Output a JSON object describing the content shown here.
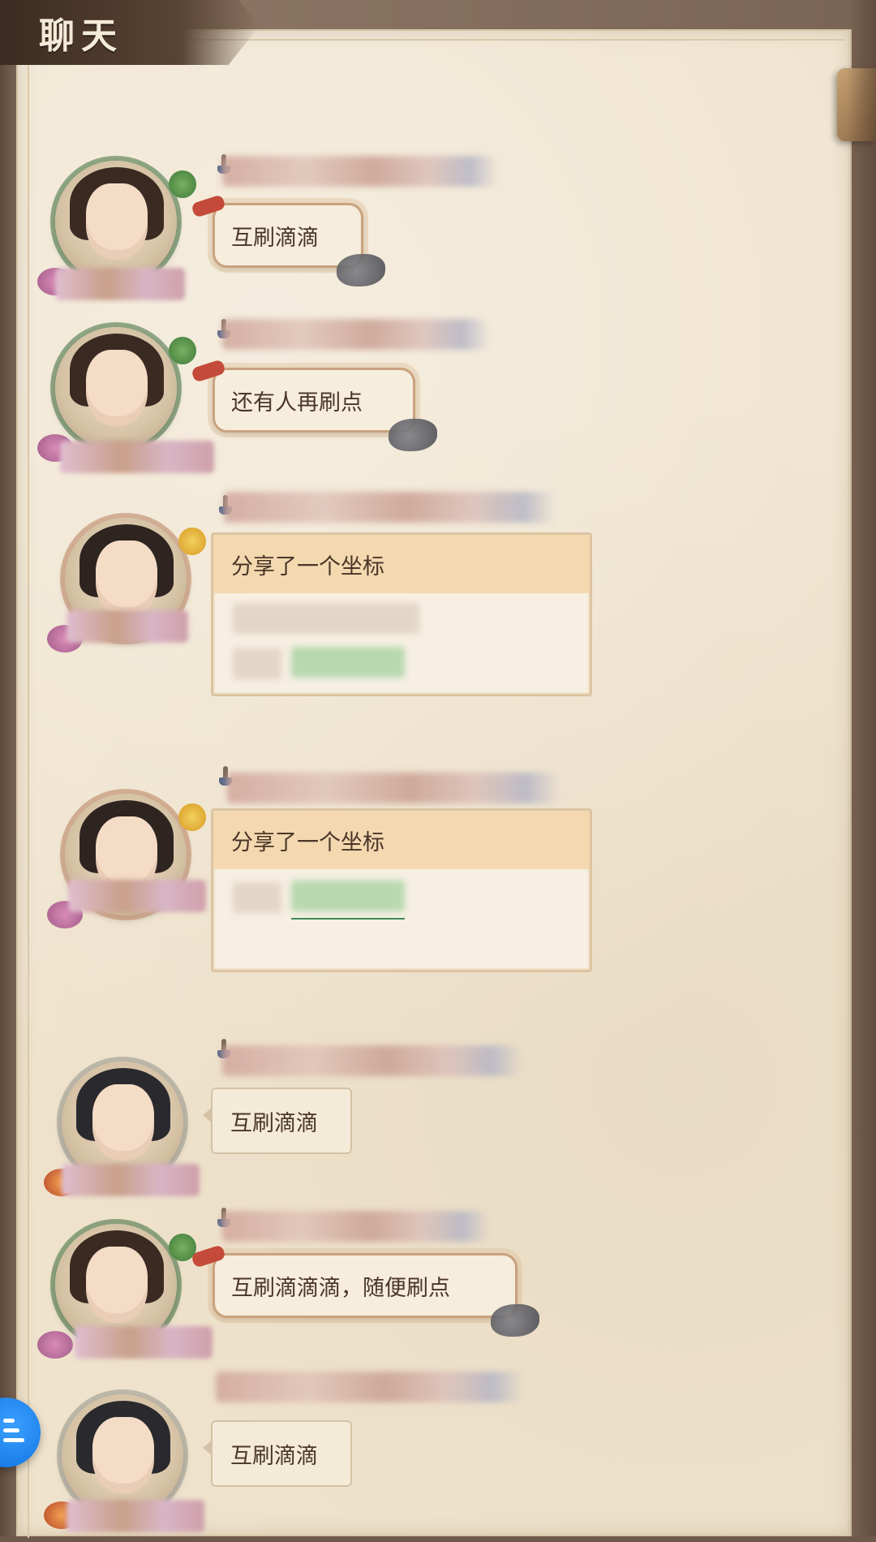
{
  "header": {
    "title": "聊天"
  },
  "messages": [
    {
      "type": "text",
      "avatar": "avatar-bamboo-warrior",
      "text": "互刷滴滴"
    },
    {
      "type": "text",
      "avatar": "avatar-bamboo-warrior",
      "text": "还有人再刷点"
    },
    {
      "type": "coordinate",
      "avatar": "avatar-flower-lady",
      "header": "分享了一个坐标"
    },
    {
      "type": "coordinate",
      "avatar": "avatar-flower-lady",
      "header": "分享了一个坐标"
    },
    {
      "type": "text",
      "avatar": "avatar-gold-crown-lady",
      "text": "互刷滴滴"
    },
    {
      "type": "text",
      "avatar": "avatar-bamboo-warrior",
      "text": "互刷滴滴滴，随便刷点"
    },
    {
      "type": "text",
      "avatar": "avatar-gold-crown-lady",
      "text": "互刷滴滴"
    }
  ],
  "colors": {
    "paper": "#efe3cd",
    "frame": "#6e5a4a",
    "coord_header": "#f3d8b0",
    "side_button": "#1a86f0"
  },
  "icons": {
    "side_button": "menu-lines-icon",
    "pin": "pin-icon"
  }
}
